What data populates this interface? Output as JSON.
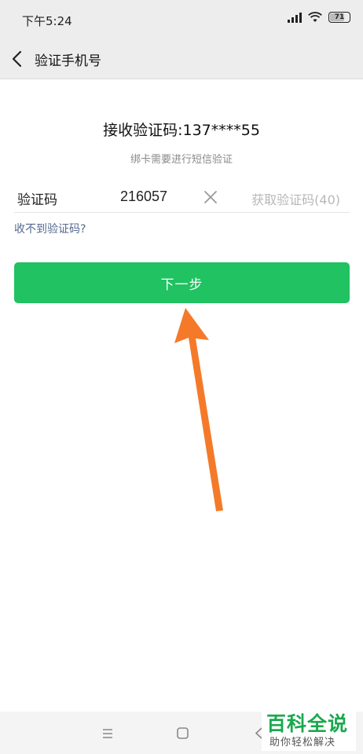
{
  "status_bar": {
    "time": "下午5:24",
    "battery": "71",
    "icons": [
      "signal-icon",
      "wifi-icon",
      "battery-icon"
    ]
  },
  "nav": {
    "back_icon": "chevron-left-icon",
    "title": "验证手机号"
  },
  "main": {
    "heading": "接收验证码:137****55",
    "subheading": "绑卡需要进行短信验证",
    "code_label": "验证码",
    "code_value": "216057",
    "clear_icon": "close-icon",
    "get_code": "获取验证码(40)",
    "not_received": "收不到验证码?",
    "next_button": "下一步"
  },
  "annotation": {
    "arrow_color": "#f47a2a",
    "arrow_icon": "arrow-up-icon"
  },
  "bottom_nav": {
    "icons": [
      "menu-icon",
      "home-square-icon",
      "back-triangle-icon"
    ]
  },
  "watermark": {
    "title": "百科全说",
    "subtitle": "助你轻松解决"
  },
  "colors": {
    "accent": "#20c261",
    "link": "#57688f",
    "header_bg": "#ededed"
  }
}
